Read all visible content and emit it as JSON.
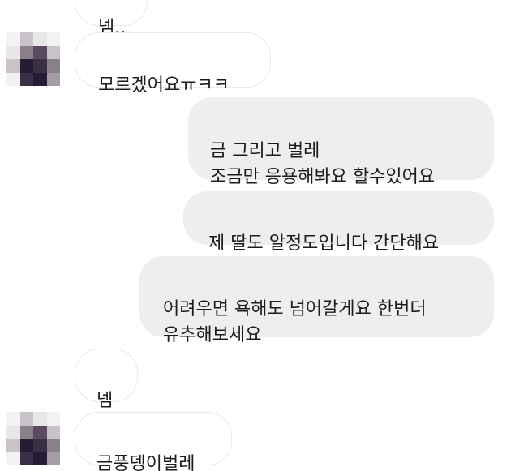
{
  "messages": [
    {
      "id": "m0",
      "direction": "incoming",
      "text": "넴.."
    },
    {
      "id": "m1",
      "direction": "incoming",
      "text": "모르겠어요ㅠㅋㅋ"
    },
    {
      "id": "m2",
      "direction": "outgoing",
      "text": "금 그리고 벌레\n조금만 응용해봐요 할수있어요"
    },
    {
      "id": "m3",
      "direction": "outgoing",
      "text": "제 딸도 알정도입니다 간단해요"
    },
    {
      "id": "m4",
      "direction": "outgoing",
      "text": "어려우면 욕해도 넘어갈게요 한번더\n유추해보세요"
    },
    {
      "id": "m5",
      "direction": "incoming",
      "text": "넴"
    },
    {
      "id": "m6",
      "direction": "incoming",
      "text": "금풍뎅이벌레"
    }
  ],
  "colors": {
    "incoming_bubble_bg": "#ffffff",
    "incoming_bubble_border": "#e9e9e9",
    "outgoing_bubble_bg": "#eeeeee",
    "text": "#1c1c1c"
  },
  "avatar": {
    "style": "pixelated (blurred) profile image",
    "palette": [
      "#e9e6ea",
      "#c9c2c9",
      "#8b7f8c",
      "#3b3046",
      "#241d33",
      "#5a4b5f",
      "#f3f1f3",
      "#a79ba6"
    ]
  }
}
